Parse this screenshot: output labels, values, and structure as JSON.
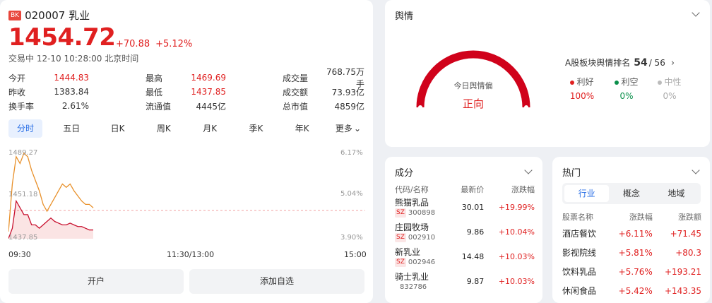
{
  "stock": {
    "badge": "BK",
    "code_name": "020007 乳业",
    "price": "1454.72",
    "change": "+70.88",
    "change_pct": "+5.12%",
    "status": "交易中 12-10 10:28:00 北京时间",
    "stats": [
      [
        {
          "k": "今开",
          "v": "1444.83",
          "c": "red"
        },
        {
          "k": "最高",
          "v": "1469.69",
          "c": "red"
        },
        {
          "k": "成交量",
          "v": "768.75万手",
          "c": "black"
        }
      ],
      [
        {
          "k": "昨收",
          "v": "1383.84",
          "c": "black"
        },
        {
          "k": "最低",
          "v": "1437.85",
          "c": "red"
        },
        {
          "k": "成交额",
          "v": "73.93亿",
          "c": "black"
        }
      ],
      [
        {
          "k": "换手率",
          "v": "2.61%",
          "c": "black"
        },
        {
          "k": "流通值",
          "v": "4445亿",
          "c": "black"
        },
        {
          "k": "总市值",
          "v": "4859亿",
          "c": "black"
        }
      ]
    ]
  },
  "tabs": [
    "分时",
    "五日",
    "日K",
    "周K",
    "月K",
    "季K",
    "年K",
    "更多"
  ],
  "chart_data": {
    "type": "line",
    "y_left_labels": [
      "1489.27",
      "1451.18",
      "1437.85"
    ],
    "y_right_labels": [
      "6.17%",
      "5.04%",
      "3.90%"
    ],
    "x_labels": [
      "09:30",
      "11:30/13:00",
      "15:00"
    ],
    "ylim": [
      1437.85,
      1489.27
    ],
    "prev_close": 1383.84,
    "series": [
      {
        "color": "#e8902a",
        "values": [
          1442,
          1470,
          1486,
          1482,
          1488,
          1486,
          1478,
          1472,
          1466,
          1458,
          1454,
          1458,
          1462,
          1466,
          1470,
          1468,
          1470,
          1466,
          1463,
          1460,
          1458,
          1458,
          1456
        ]
      },
      {
        "color": "#c8102e",
        "values": [
          1438,
          1444,
          1460,
          1456,
          1452,
          1452,
          1446,
          1446,
          1444,
          1446,
          1448,
          1450,
          1448,
          1447,
          1446,
          1446,
          1447,
          1446,
          1445,
          1445,
          1444,
          1443,
          1443
        ]
      }
    ]
  },
  "buttons": {
    "open_account": "开户",
    "add_watch": "添加自选"
  },
  "sentiment": {
    "title": "舆情",
    "gauge_label": "今日舆情偏",
    "gauge_value": "正向",
    "rank_label": "A股板块舆情排名",
    "rank_value": "54",
    "rank_total": "/ 56",
    "items": [
      {
        "label": "利好",
        "value": "100%",
        "color": "#e02020"
      },
      {
        "label": "利空",
        "value": "0%",
        "color": "#0a8f4a"
      },
      {
        "label": "中性",
        "value": "0%",
        "color": "#bbbbbb"
      }
    ]
  },
  "components": {
    "title": "成分",
    "headers": [
      "代码/名称",
      "最新价",
      "涨跌幅"
    ],
    "rows": [
      {
        "name": "熊猫乳品",
        "tag": "SZ",
        "code": "300898",
        "price": "30.01",
        "pct": "+19.99%"
      },
      {
        "name": "庄园牧场",
        "tag": "SZ",
        "code": "002910",
        "price": "9.86",
        "pct": "+10.04%"
      },
      {
        "name": "新乳业",
        "tag": "SZ",
        "code": "002946",
        "price": "14.48",
        "pct": "+10.03%"
      },
      {
        "name": "骑士乳业",
        "tag": "",
        "code": "832786",
        "price": "9.87",
        "pct": "+10.03%"
      }
    ]
  },
  "hot": {
    "title": "热门",
    "tabs": [
      "行业",
      "概念",
      "地域"
    ],
    "headers": [
      "股票名称",
      "涨跌幅",
      "涨跌额"
    ],
    "rows": [
      {
        "name": "酒店餐饮",
        "pct": "+6.11%",
        "amt": "+71.45"
      },
      {
        "name": "影视院线",
        "pct": "+5.81%",
        "amt": "+80.3"
      },
      {
        "name": "饮料乳品",
        "pct": "+5.76%",
        "amt": "+193.21"
      },
      {
        "name": "休闲食品",
        "pct": "+5.42%",
        "amt": "+143.35"
      }
    ]
  }
}
